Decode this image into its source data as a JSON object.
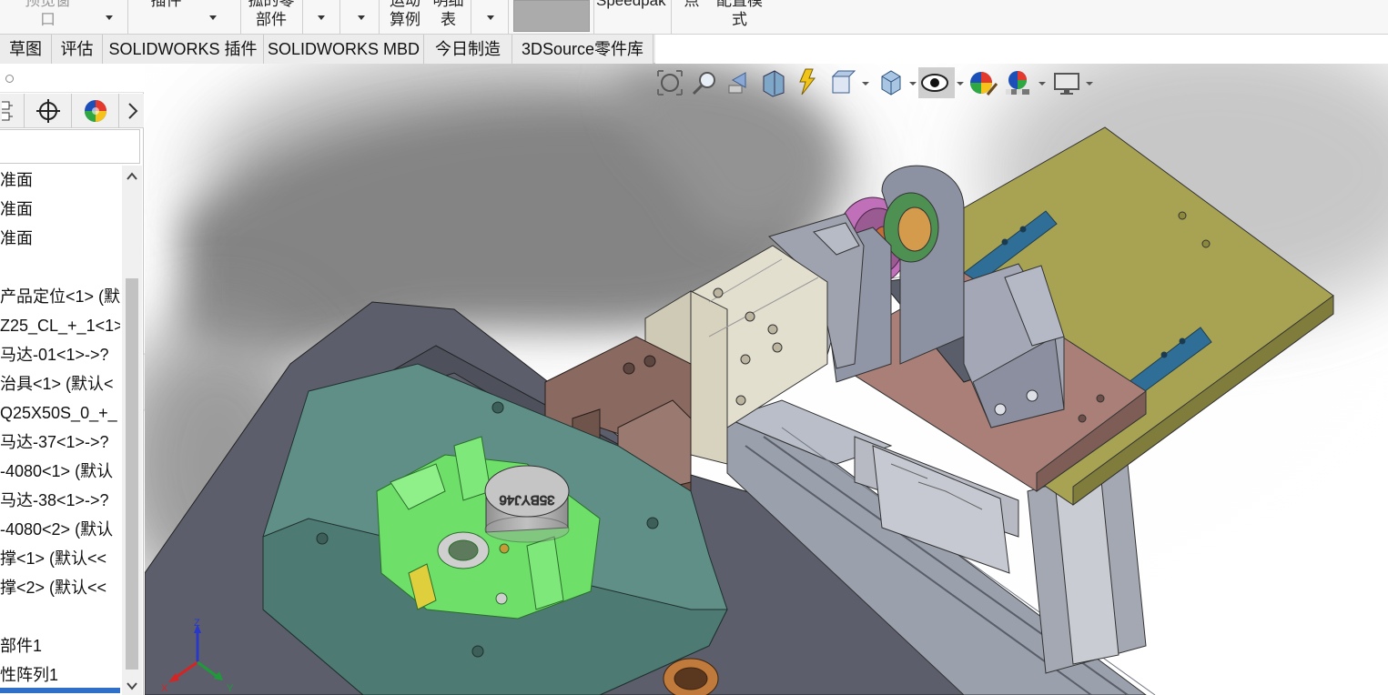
{
  "ribbon": {
    "items": [
      {
        "line1": "预览窗",
        "line2": "口"
      },
      {
        "line1": "插件",
        "line2": ""
      },
      {
        "line1": "孤的零",
        "line2": "部件"
      },
      {
        "line1": "运动",
        "line2": "算例"
      },
      {
        "line1": "明细",
        "line2": "表"
      },
      {
        "line1": "Speedpak",
        "line2": ""
      },
      {
        "line1": "点",
        "line2": ""
      },
      {
        "line1": "配置模",
        "line2": "式"
      }
    ]
  },
  "tabs": [
    "草图",
    "评估",
    "SOLIDWORKS 插件",
    "SOLIDWORKS MBD",
    "今日制造",
    "3DSource零件库"
  ],
  "feature_tree": {
    "items": [
      "准面",
      "准面",
      "准面",
      "",
      "产品定位<1> (默",
      "Z25_CL_+_1<1>",
      "马达-01<1>->?",
      "治具<1> (默认<",
      "Q25X50S_0_+_",
      "马达-37<1>->?",
      "-4080<1> (默认",
      "马达-38<1>->?",
      "-4080<2> (默认",
      "撑<1> (默认<<",
      "撑<2> (默认<<",
      "",
      "部件1",
      "性阵列1"
    ]
  },
  "view_toolbar": {
    "icons": [
      "zoom-to-fit-icon",
      "zoom-to-area-icon",
      "previous-view-icon",
      "section-view-icon",
      "dynamic-annotation-icon",
      "view-orientation-icon",
      "display-style-icon",
      "hide-show-items-icon",
      "edit-appearance-icon",
      "apply-scene-icon",
      "view-settings-icon"
    ]
  },
  "model": {
    "motor_label": "35BYJ46"
  },
  "triad": {
    "x": "X",
    "y": "Y",
    "z": "Z"
  },
  "colors": {
    "base_plate": "#5c5f6b",
    "fixture_teal": "#5f8f86",
    "pcb_green": "#6ee06a",
    "bracket_brown": "#8a6a60",
    "slide_cream": "#e3dfcf",
    "plate_olive": "#a7a352",
    "rail_blue": "#2f6e96",
    "gear_pink": "#c070b8",
    "rack_dark": "#555a66"
  }
}
